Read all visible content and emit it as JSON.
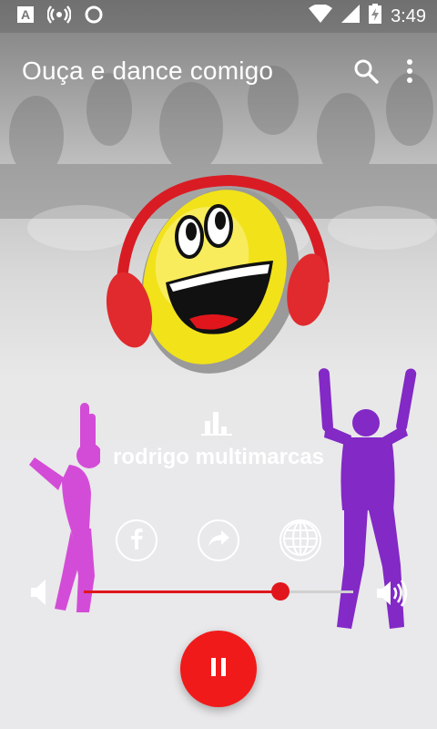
{
  "status_bar": {
    "time": "3:49",
    "icons": [
      "android-a-icon",
      "hotspot-icon",
      "circle-icon",
      "wifi-icon",
      "signal-icon",
      "battery-charging-icon"
    ]
  },
  "toolbar": {
    "title": "Ouça e dance comigo",
    "search_icon": "search-icon",
    "menu_icon": "more-vert-icon"
  },
  "player": {
    "station_name": "rodrigo multimarcas",
    "volume_level": 0.73,
    "state_icon": "pause-icon"
  },
  "social": {
    "items": [
      "facebook-icon",
      "share-icon",
      "globe-icon"
    ]
  },
  "colors": {
    "accent": "#e0161c",
    "play_button": "#f11a1a",
    "dancer_left": "#d23fd6",
    "dancer_right": "#7a19c4"
  }
}
